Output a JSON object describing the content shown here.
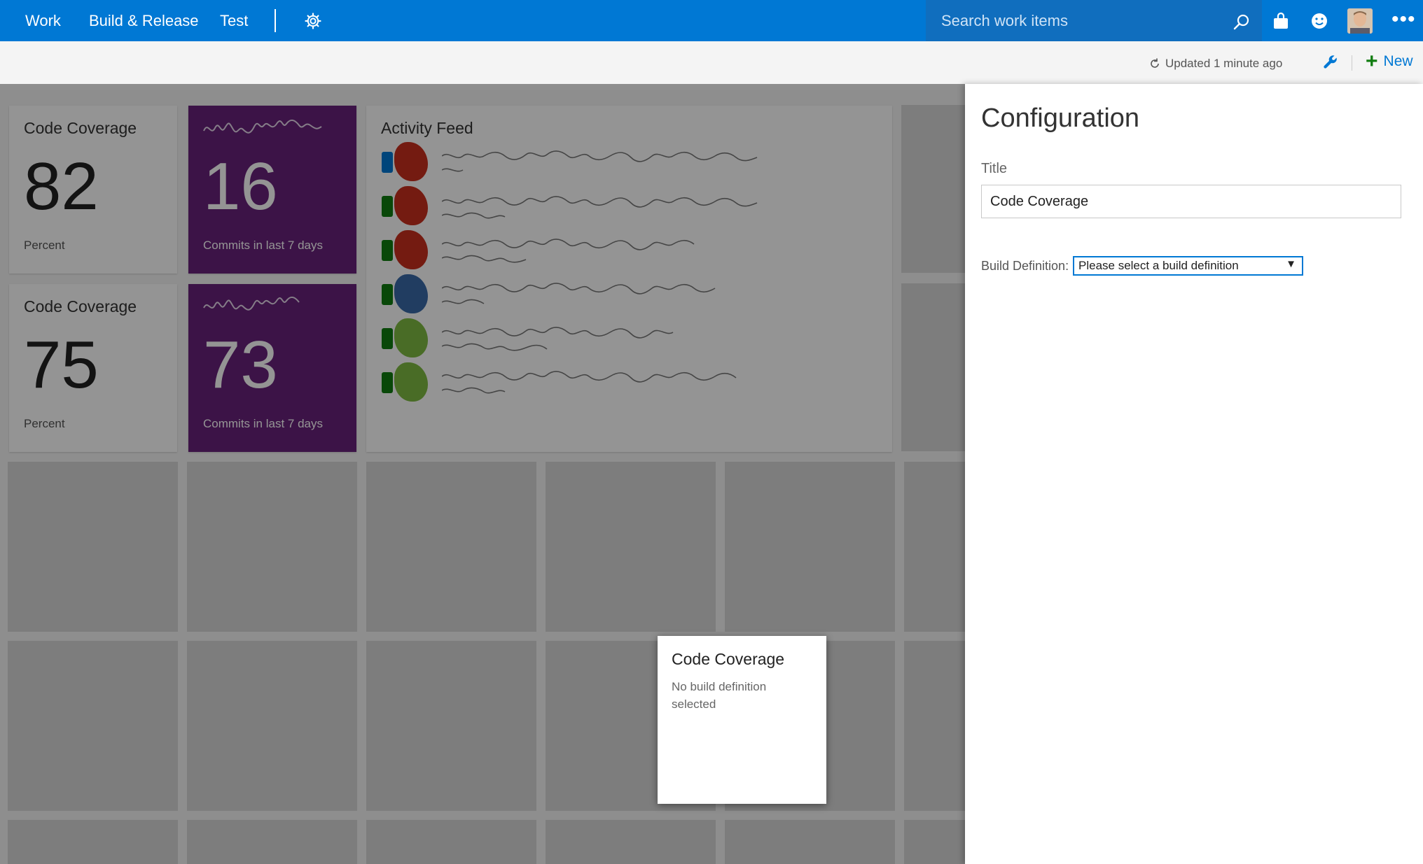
{
  "nav": {
    "items": [
      "Work",
      "Build & Release",
      "Test"
    ],
    "search_placeholder": "Search work items"
  },
  "toolbar": {
    "updated_text": "Updated 1 minute ago",
    "new_label": "New"
  },
  "dashboard": {
    "tiles": [
      {
        "title": "Code Coverage",
        "value": "82",
        "caption": "Percent"
      },
      {
        "value": "16",
        "caption": "Commits in last 7 days"
      },
      {
        "title": "Code Coverage",
        "value": "75",
        "caption": "Percent"
      },
      {
        "value": "73",
        "caption": "Commits in last 7 days"
      }
    ],
    "activity_feed_title": "Activity Feed",
    "floating_tile": {
      "title": "Code Coverage",
      "message": "No build definition selected"
    }
  },
  "config": {
    "heading": "Configuration",
    "title_label": "Title",
    "title_value": "Code Coverage",
    "build_definition_label": "Build Definition:",
    "build_definition_selected": "Please select a build definition"
  },
  "colors": {
    "brand_blue": "#0078d4",
    "purple_tile": "#68217a",
    "green_plus": "#107c10"
  }
}
